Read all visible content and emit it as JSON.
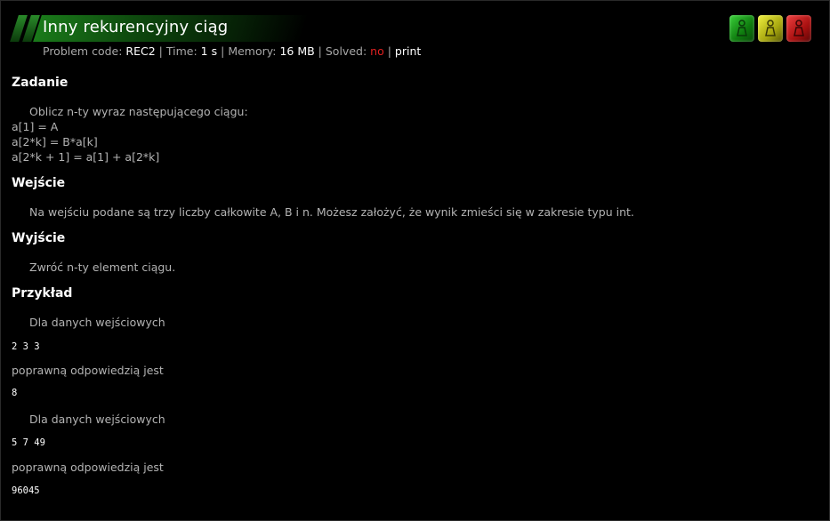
{
  "problem": {
    "title": "Inny rekurencyjny ciąg",
    "meta": {
      "code_label": "Problem code:",
      "code": "REC2",
      "time_label": "Time:",
      "time": "1 s",
      "memory_label": "Memory:",
      "memory": "16 MB",
      "solved_label": "Solved:",
      "solved": "no",
      "print": "print",
      "separator": "|"
    },
    "icons": [
      "green-person-icon",
      "yellow-person-icon",
      "red-person-icon"
    ],
    "accent_colors": {
      "green": "#1a7a1a",
      "no": "#e02020"
    }
  },
  "sections": {
    "task": {
      "heading": "Zadanie",
      "intro": "Oblicz n-ty wyraz następującego ciągu:",
      "lines": [
        "a[1] = A",
        "a[2*k] = B*a[k]",
        "a[2*k + 1] = a[1] + a[2*k]"
      ]
    },
    "input": {
      "heading": "Wejście",
      "text": "Na wejściu podane są trzy liczby całkowite A, B i n. Możesz założyć, że wynik zmieści się w zakresie typu int."
    },
    "output": {
      "heading": "Wyjście",
      "text": "Zwróć n-ty element ciągu."
    },
    "example": {
      "heading": "Przykład",
      "cases": [
        {
          "input_label": "Dla danych wejściowych",
          "input": "2 3 3",
          "output_label": "poprawną odpowiedzią jest",
          "output": "8"
        },
        {
          "input_label": "Dla danych wejściowych",
          "input": "5 7 49",
          "output_label": "poprawną odpowiedzią jest",
          "output": "96045"
        }
      ]
    }
  }
}
